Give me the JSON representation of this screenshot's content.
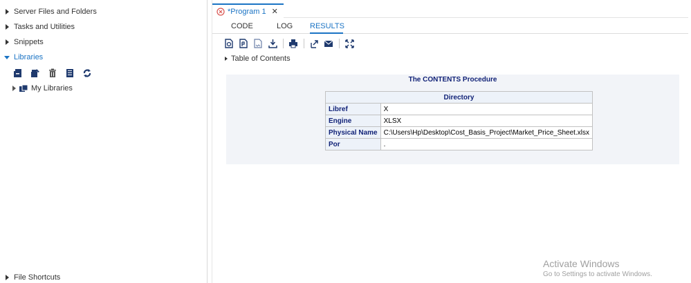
{
  "nav": {
    "sections": [
      {
        "label": "Server Files and Folders",
        "expanded": false
      },
      {
        "label": "Tasks and Utilities",
        "expanded": false
      },
      {
        "label": "Snippets",
        "expanded": false
      },
      {
        "label": "Libraries",
        "expanded": true
      }
    ],
    "library_toolbar_icons": [
      "new-library-icon",
      "library-properties-icon",
      "delete-icon",
      "table-view-icon",
      "refresh-icon"
    ],
    "tree": [
      {
        "label": "My Libraries"
      }
    ],
    "footer_section": {
      "label": "File Shortcuts"
    }
  },
  "editor": {
    "tab_title": "*Program 1",
    "tab_close": "✕",
    "sub_tabs": [
      "CODE",
      "LOG",
      "RESULTS"
    ],
    "active_sub_tab": "RESULTS",
    "results_toolbar_icons": [
      "open-html-icon",
      "download-pdf-icon",
      "download-rtf-icon",
      "download-icon",
      "print-icon",
      "open-new-window-icon",
      "email-icon",
      "maximize-icon"
    ],
    "toc_label": "Table of Contents"
  },
  "results": {
    "procedure_title": "The CONTENTS Procedure",
    "table_header": "Directory",
    "rows": [
      {
        "label": "Libref",
        "value": "X"
      },
      {
        "label": "Engine",
        "value": "XLSX"
      },
      {
        "label": "Physical Name",
        "value": "C:\\Users\\Hp\\Desktop\\Cost_Basis_Project\\Market_Price_Sheet.xlsx"
      },
      {
        "label": "Por",
        "value": "."
      }
    ]
  },
  "watermark": {
    "line1": "Activate Windows",
    "line2": "Go to Settings to activate Windows."
  },
  "colors": {
    "accent": "#1a73c4",
    "table_header_text": "#112277",
    "table_header_bg": "#edf2f9",
    "results_bg": "#f2f4f8",
    "error_icon": "#d9534f"
  }
}
